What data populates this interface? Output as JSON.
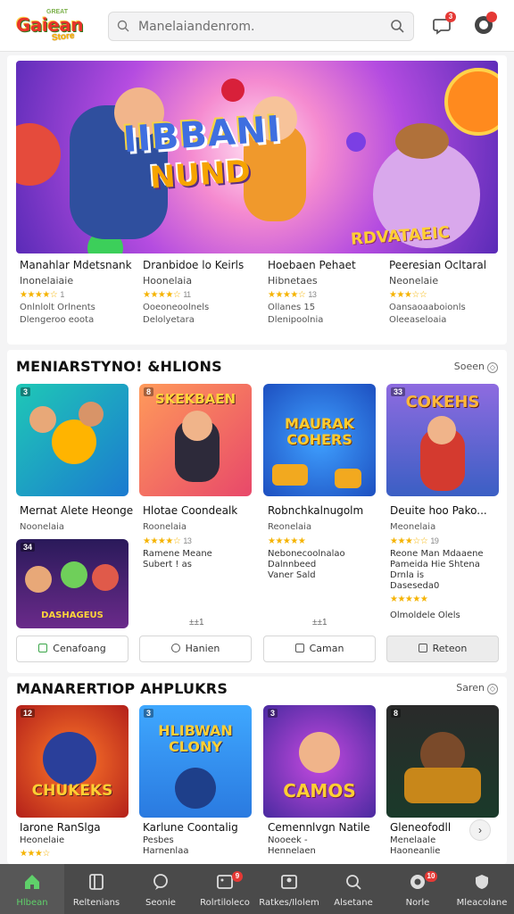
{
  "header": {
    "logo_top": "GREAT",
    "logo_text": "Gaiean",
    "logo_sub": "Store",
    "search_placeholder": "Manelaiandenrom.",
    "notif_badge": "3"
  },
  "hero": {
    "banner_title_1": "IIBBANI",
    "banner_title_2": "NUND",
    "banner_title_3": "RDVATAEIC",
    "games": [
      {
        "title": "Manahlar Mdetsnank",
        "sub": "Inonelaiaie",
        "rating_count": "1",
        "line1": "Onlnlolt Orlnents",
        "line2": "Dlengeroo eoota"
      },
      {
        "title": "Dranbidoe lo Keirls",
        "sub": "Hoonelaia",
        "rating_count": "11",
        "line1": "Ooeoneoolnels",
        "line2": "Delolyetara"
      },
      {
        "title": "Hoebaen Pehaet",
        "sub": "Hibnetaes",
        "rating_count": "13",
        "line1": "Ollanes 15",
        "line2": "Dlenipoolnia"
      },
      {
        "title": "Peeresian Ocltaral",
        "sub": "Neonelaie",
        "rating_count": "",
        "line1": "Oansaoaaboionls",
        "line2": "Oleeaseloaia"
      }
    ]
  },
  "section1": {
    "title": "MENIARSTYNO! &HLIONS",
    "see_all": "Soeen",
    "thumbs": [
      {
        "tag": "3",
        "title": ""
      },
      {
        "tag": "8",
        "title": "SKEKBAEN"
      },
      {
        "tag": "",
        "title": "MAURAK COHERS"
      },
      {
        "tag": "33",
        "title": "COKEHS"
      },
      {
        "tag": "34",
        "title": "DASHAGEUS"
      }
    ],
    "cards": [
      {
        "title": "Mernat Alete Heonge",
        "sub": "Noonelaia",
        "rating_count": "",
        "lines": []
      },
      {
        "title": "Hlotae Coondealk",
        "sub": "Roonelaia",
        "rating_count": "13",
        "lines": [
          "Ramene Meane",
          "Subert ! as"
        ]
      },
      {
        "title": "Robnchkalnugolm",
        "sub": "Reonelaia",
        "rating_count": "",
        "lines": [
          "Nebonecoolnalao",
          "Dalnnbeed",
          "Vaner Sald"
        ]
      },
      {
        "title": "Deuite hoo Pako...",
        "sub": "Meonelaia",
        "rating_count": "19",
        "lines": [
          "Reone Man Mdaaene",
          "Pameida Hie Shtena",
          "Drnla is",
          "Daseseda0"
        ]
      }
    ],
    "extra_line": "Olmoldele Olels",
    "counters": [
      "±±1",
      "±±1"
    ],
    "buttons": [
      "Cenafoang",
      "Hanien",
      "Caman",
      "Reteon"
    ]
  },
  "section2": {
    "title": "MANARERTIOP AHPLUKRS",
    "see_all": "Saren",
    "thumbs": [
      {
        "tag": "12",
        "title": "CHUKEKS"
      },
      {
        "tag": "3",
        "title": "HLIBWAN CLONY"
      },
      {
        "tag": "3",
        "title": "CAMOS"
      },
      {
        "tag": "8",
        "title": ""
      }
    ],
    "cards": [
      {
        "title": "Iarone RanSlga",
        "sub": "Heonelaie",
        "line": ""
      },
      {
        "title": "Karlune Coontalig",
        "sub": "Pesbes",
        "line": "Harnenlaa"
      },
      {
        "title": "Cemennlvgn Natile",
        "sub": "Nooeek -",
        "line": "Hennelaen"
      },
      {
        "title": "Gleneofodll",
        "sub": "Menelaale",
        "line": "Haoneanlie"
      }
    ]
  },
  "bottom_nav": {
    "items": [
      {
        "label": "Hlbean",
        "icon": "home-icon",
        "badge": ""
      },
      {
        "label": "Reltenians",
        "icon": "book-icon",
        "badge": ""
      },
      {
        "label": "Seonie",
        "icon": "chat-icon",
        "badge": ""
      },
      {
        "label": "Rolrtiloleco",
        "icon": "image-icon",
        "badge": "9"
      },
      {
        "label": "Ratkes/Ilolem",
        "icon": "profile-card-icon",
        "badge": ""
      },
      {
        "label": "Alsetane",
        "icon": "search-person-icon",
        "badge": ""
      },
      {
        "label": "Norle",
        "icon": "gamepad-icon",
        "badge": "10"
      },
      {
        "label": "Mleacolane",
        "icon": "shield-icon",
        "badge": ""
      }
    ]
  },
  "colors": {
    "accent_green": "#5fd06a",
    "star": "#f5b301",
    "badge_red": "#e53935",
    "nav_bg": "#4a4a4a"
  }
}
